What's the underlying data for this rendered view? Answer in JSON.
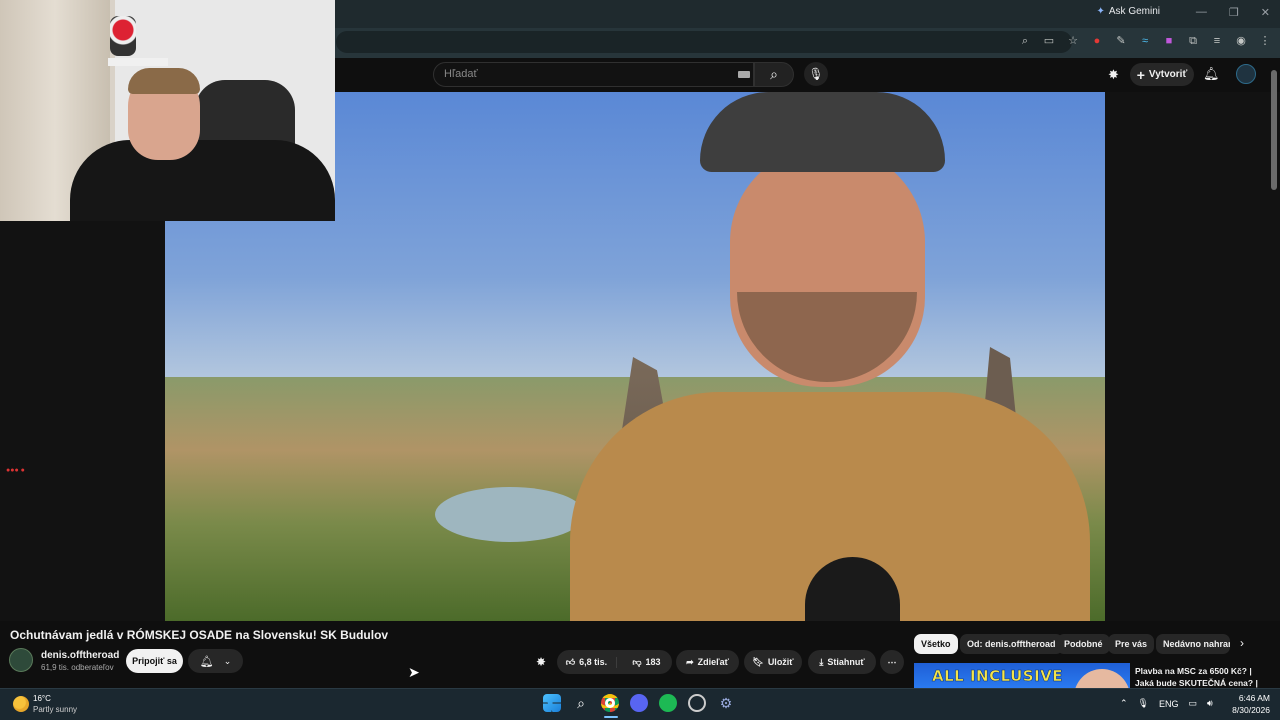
{
  "browser": {
    "ask_gemini": "Ask Gemini",
    "window_controls": [
      "—",
      "❐",
      "✕"
    ]
  },
  "header": {
    "search_placeholder": "Hľadať",
    "create_label": "Vytvoriť"
  },
  "video": {
    "title": "Ochutnávam jedlá v RÓMSKEJ OSADE na Slovensku! SK Budulov",
    "channel_name": "denis.offtheroad",
    "channel_subs": "61,9 tis. odberateľov",
    "join_label": "Pripojiť sa"
  },
  "actions": {
    "likes": "6,8 tis.",
    "dislikes": "183",
    "share": "Zdieľať",
    "save": "Uložiť",
    "download": "Stiahnuť"
  },
  "chips": [
    "Všetko",
    "Od: denis.offtheroad",
    "Podobné",
    "Pre vás",
    "Nedávno nahrané"
  ],
  "recommendation": {
    "thumb_text": "ALL INCLUSIVE",
    "title": "Plavba na MSC za 6500 Kč? | Jaká bude SKUTEČNÁ cena? |"
  },
  "taskbar": {
    "temperature": "16°C",
    "weather": "Partly sunny",
    "language": "ENG",
    "time": "6:46 AM",
    "date": "8/30/2026"
  },
  "colors": {
    "accent": "#3ea6ff",
    "background": "#0f0f0f",
    "chip_active": "#f1f1f1"
  }
}
